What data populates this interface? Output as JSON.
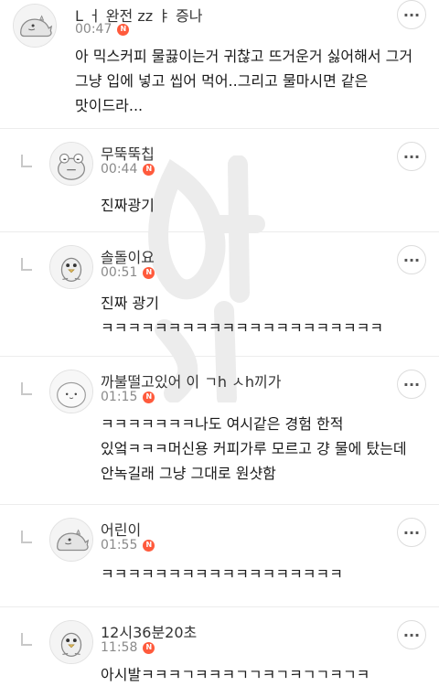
{
  "icons": {
    "more": "more-options-icon",
    "reply": "reply-arrow-icon",
    "new": "new-badge-icon"
  },
  "colors": {
    "badge": "#ff5a3c",
    "time": "#8a8a8a",
    "divider": "#ececec"
  },
  "badge_label": "N",
  "more_label": "···",
  "comments": [
    {
      "nickname": "L ㅓ 완전 zz ㅑ 증나",
      "time": "00:47",
      "text": "아 믹스커피 물끓이는거 귀찮고 뜨거운거 싫어해서 그거 그냥 입에 넣고 씹어 먹어..그리고 물마시면 같은 맛이드라..."
    },
    {
      "nickname": "무뚝뚝칩",
      "time": "00:44",
      "text": "진짜광기"
    },
    {
      "nickname": "솔돌이요",
      "time": "00:51",
      "text": "진짜 광기 ㅋㅋㅋㅋㅋㅋㅋㅋㅋㅋㅋㅋㅋㅋㅋㅋㅋㅋㅋㅋㅋ"
    },
    {
      "nickname": "까불떨고있어 이 ㄱh ㅅh끼가",
      "time": "01:15",
      "text": "ㅋㅋㅋㅋㅋㅋㅋ나도 여시같은 경험 한적 있엌ㅋㅋㅋ머신용 커피가루 모르고 걍 물에 탔는데 안녹길래 그냥 그대로 원샷함"
    },
    {
      "nickname": "어린이",
      "time": "01:55",
      "text": "ㅋㅋㅋㅋㅋㅋㅋㅋㅋㅋㅋㅋㅋㅋㅋㅋㅋㅋ"
    },
    {
      "nickname": "12시36분20초",
      "time": "11:58",
      "text": "아시발ㅋㅋㅋㄱㅋㅋㅋㄱㄱㅋㄱㅋㄱㄱㅋㄱㅋ"
    }
  ]
}
